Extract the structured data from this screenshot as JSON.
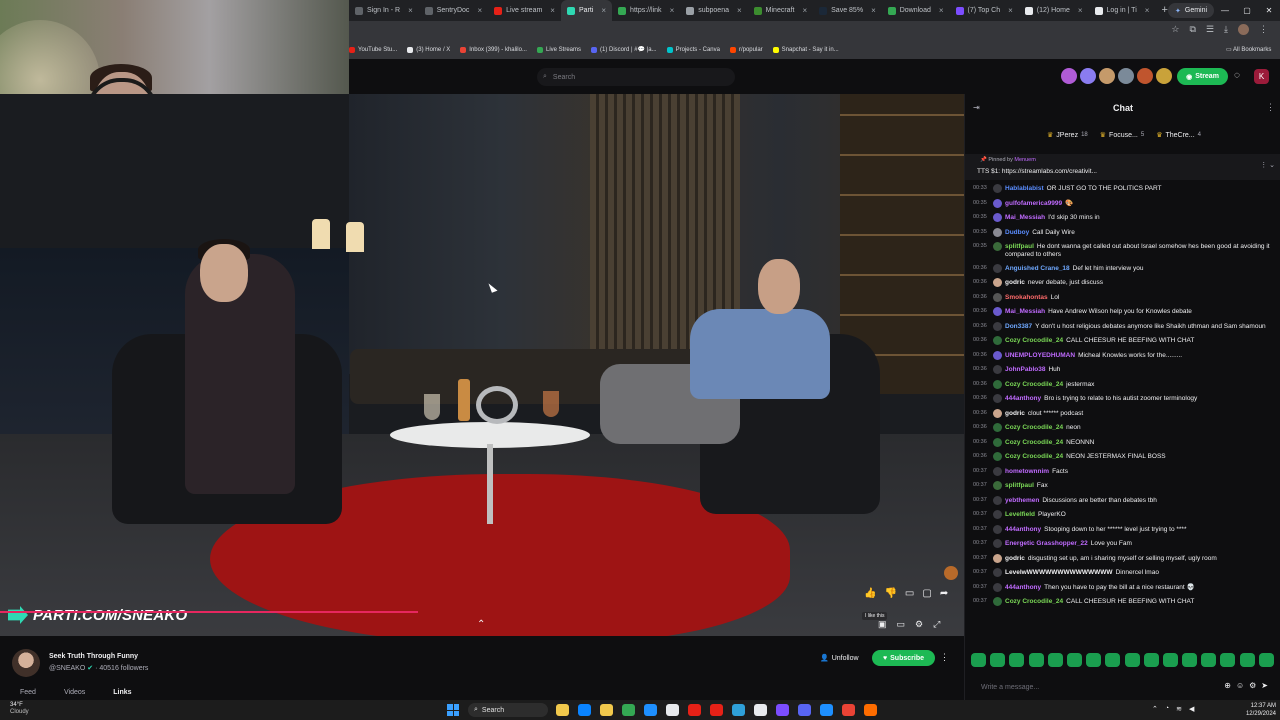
{
  "browser": {
    "tabs": [
      {
        "label": "Sign In - R",
        "color": "#5f6368"
      },
      {
        "label": "SentryDoc",
        "color": "#5f6368"
      },
      {
        "label": "Live stream",
        "color": "#e62117"
      },
      {
        "label": "Parti",
        "color": "#2fd9b3"
      },
      {
        "label": "https://link",
        "color": "#34a853"
      },
      {
        "label": "subpoena",
        "color": "#9aa0a6"
      },
      {
        "label": "Minecraft",
        "color": "#3c8d2f"
      },
      {
        "label": "Save 85%",
        "color": "#1b2838"
      },
      {
        "label": "Download",
        "color": "#34a853"
      },
      {
        "label": "(7) Top Ch",
        "color": "#7c4dff"
      },
      {
        "label": "(12) Home",
        "color": "#e8eaed"
      },
      {
        "label": "Log in | Ti",
        "color": "#e8eaed"
      }
    ],
    "new_tab": "+",
    "gemini_label": "Gemini",
    "window_controls": [
      "—",
      "▢",
      "✕"
    ],
    "bookmarks": [
      {
        "label": "YouTube Stu...",
        "color": "#e62117"
      },
      {
        "label": "(3) Home / X",
        "color": "#e8eaed"
      },
      {
        "label": "Inbox (399) - khalilo...",
        "color": "#ea4335"
      },
      {
        "label": "Live Streams",
        "color": "#34a853"
      },
      {
        "label": "(1) Discord | #💬 |a...",
        "color": "#5865f2"
      },
      {
        "label": "Projects - Canva",
        "color": "#00c4cc"
      },
      {
        "label": "r/popular",
        "color": "#ff4500"
      },
      {
        "label": "Snapchat - Say it in...",
        "color": "#fffc00"
      }
    ],
    "all_bookmarks": "All Bookmarks"
  },
  "site": {
    "search_placeholder": "Search",
    "stream_label": "Stream",
    "user_initial": "K",
    "avatar_colors": [
      "#b05bd6",
      "#8a7cf0",
      "#c59a6a",
      "#7b8a99",
      "#c0552e",
      "#c9a23a"
    ]
  },
  "video": {
    "overlay_text": "PARTI.COM/SNEAKO",
    "progress": 0.434,
    "like_tooltip": "I like this"
  },
  "channel": {
    "title": "Seek Truth Through Funny",
    "handle": "@SNEAKO",
    "followers": "40516",
    "followers_label": "followers",
    "unfollow_label": "Unfollow",
    "subscribe_label": "Subscribe",
    "tabs": [
      "Feed",
      "Videos",
      "Links"
    ],
    "active_tab": "Links"
  },
  "chat": {
    "title": "Chat",
    "top_chatters": [
      {
        "name": "JPerez",
        "count": "18"
      },
      {
        "name": "Focuse...",
        "count": "5"
      },
      {
        "name": "TheCre...",
        "count": "4"
      }
    ],
    "pinned_by": "Pinned by",
    "pinned_user": "Menuem",
    "pinned_message": "TTS $1: https://streamlabs.com/creativit...",
    "input_placeholder": "Write a message..."
  },
  "messages": [
    {
      "time": "00:33",
      "user": "Hablablabist",
      "color": "#5a8dff",
      "text": "OR JUST GO TO THE POLITICS PART",
      "av": "#3a3a40"
    },
    {
      "time": "00:35",
      "user": "gulfofamerica9999",
      "color": "#c06bff",
      "text": "🎨",
      "av": "#6a5acd"
    },
    {
      "time": "00:35",
      "user": "Mai_Messiah",
      "color": "#c06bff",
      "text": "I'd skip 30 mins in",
      "av": "#6a5acd"
    },
    {
      "time": "00:35",
      "user": "Dudboy",
      "color": "#5a8dff",
      "text": "Call Daily Wire",
      "av": "#8a8a93"
    },
    {
      "time": "00:35",
      "user": "splitfpaul",
      "color": "#7bd957",
      "text": "He dont wanna get called out about Israel somehow hes been good at avoiding it compared to others",
      "av": "#3a6a3a"
    },
    {
      "time": "00:36",
      "user": "Anguished Crane_18",
      "color": "#6fa8ff",
      "text": "Def let him interview you",
      "av": "#3a3a40"
    },
    {
      "time": "00:36",
      "user": "godric",
      "color": "#efeff1",
      "text": "never debate, just discuss",
      "av": "#c9a48c"
    },
    {
      "time": "00:36",
      "user": "Smokahontas",
      "color": "#ff6b6b",
      "text": "Lol",
      "av": "#555"
    },
    {
      "time": "00:36",
      "user": "Mai_Messiah",
      "color": "#c06bff",
      "text": "Have Andrew Wilson help you for Knowles debate",
      "av": "#6a5acd"
    },
    {
      "time": "00:36",
      "user": "Don3387",
      "color": "#6fa8ff",
      "text": "Y don't u host religious debates anymore like Shaikh uthman and Sam shamoun",
      "av": "#3a3a40"
    },
    {
      "time": "00:36",
      "user": "Cozy Crocodile_24",
      "color": "#7bd957",
      "text": "CALL CHEESUR HE BEEFING WITH CHAT",
      "av": "#2f6a3a"
    },
    {
      "time": "00:36",
      "user": "UNEMPLOYEDHUMAN",
      "color": "#c06bff",
      "text": "Micheal Knowles works for the.........",
      "av": "#6a5acd"
    },
    {
      "time": "00:36",
      "user": "JohnPablo38",
      "color": "#c06bff",
      "text": "Huh",
      "av": "#3a3a40"
    },
    {
      "time": "00:36",
      "user": "Cozy Crocodile_24",
      "color": "#7bd957",
      "text": "jestermax",
      "av": "#2f6a3a"
    },
    {
      "time": "00:36",
      "user": "444anthony",
      "color": "#c06bff",
      "text": "Bro is trying to relate to his autist zoomer terminology",
      "av": "#3a3a40"
    },
    {
      "time": "00:36",
      "user": "godric",
      "color": "#efeff1",
      "text": "clout ****** podcast",
      "av": "#c9a48c"
    },
    {
      "time": "00:36",
      "user": "Cozy Crocodile_24",
      "color": "#7bd957",
      "text": "neon",
      "av": "#2f6a3a"
    },
    {
      "time": "00:36",
      "user": "Cozy Crocodile_24",
      "color": "#7bd957",
      "text": "NEONNN",
      "av": "#2f6a3a"
    },
    {
      "time": "00:36",
      "user": "Cozy Crocodile_24",
      "color": "#7bd957",
      "text": "NEON JESTERMAX FINAL BOSS",
      "av": "#2f6a3a"
    },
    {
      "time": "00:37",
      "user": "hometownnim",
      "color": "#c06bff",
      "text": "Facts",
      "av": "#3a3a40"
    },
    {
      "time": "00:37",
      "user": "splitfpaul",
      "color": "#7bd957",
      "text": "Fax",
      "av": "#3a6a3a"
    },
    {
      "time": "00:37",
      "user": "yebthemen",
      "color": "#c06bff",
      "text": "Discussions are better than debates tbh",
      "av": "#3a3a40"
    },
    {
      "time": "00:37",
      "user": "Levelfield",
      "color": "#7bd957",
      "text": "PlayerKO",
      "av": "#3a3a40"
    },
    {
      "time": "00:37",
      "user": "444anthony",
      "color": "#c06bff",
      "text": "Stooping down to her ****** level just trying to ****",
      "av": "#3a3a40"
    },
    {
      "time": "00:37",
      "user": "Energetic Grasshopper_22",
      "color": "#c06bff",
      "text": "Love you Fam",
      "av": "#3a3a40"
    },
    {
      "time": "00:37",
      "user": "godric",
      "color": "#efeff1",
      "text": "disgusting set up, am i sharing myself or selling myself, ugly room",
      "av": "#c9a48c"
    },
    {
      "time": "00:37",
      "user": "LevelwWWWWWWWWWWWWWW",
      "color": "#efeff1",
      "text": "Dinnercel lmao",
      "av": "#3a3a40"
    },
    {
      "time": "00:37",
      "user": "444anthony",
      "color": "#c06bff",
      "text": "Then you have to pay the bill at a nice restaurant 💀",
      "av": "#3a3a40"
    },
    {
      "time": "00:37",
      "user": "Cozy Crocodile_24",
      "color": "#7bd957",
      "text": "CALL CHEESUR HE BEEFING WITH CHAT",
      "av": "#2f6a3a"
    }
  ],
  "taskbar": {
    "temp": "34°F",
    "condition": "Cloudy",
    "search_label": "Search",
    "time": "12:37 AM",
    "date": "12/29/2024",
    "app_colors": [
      "#f2c94c",
      "#0a84ff",
      "#f2c94c",
      "#34a853",
      "#1e90ff",
      "#e8eaed",
      "#e62117",
      "#e62117",
      "#2fa0d8",
      "#e8eaed",
      "#7c4dff",
      "#5865f2",
      "#1e90ff",
      "#ea4335",
      "#ff6d00"
    ]
  }
}
